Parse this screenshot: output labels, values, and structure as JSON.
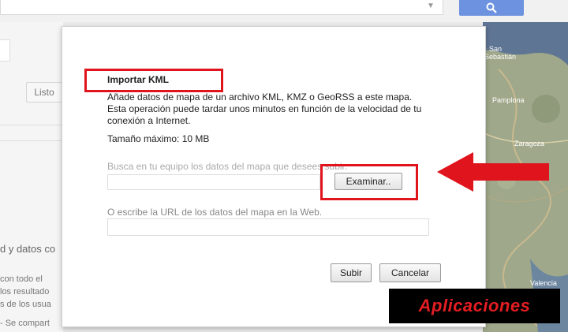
{
  "header": {
    "search_value": "",
    "search_icon": "search-icon"
  },
  "background": {
    "list_button": "Listo",
    "heading": "d y datos co",
    "lines": [
      "con todo el",
      "los resultado",
      "s de los usua",
      "- Se compart"
    ]
  },
  "map": {
    "places": [
      "San",
      "Sebastián",
      "Pamplona",
      "Zaragoza",
      "Valencia"
    ]
  },
  "dialog": {
    "title": "Importar KML",
    "description": "Añade datos de mapa de un archivo KML, KMZ o GeoRSS a este mapa. Esta operación puede tardar unos minutos en función de la velocidad de tu conexión a Internet.",
    "max_size": "Tamaño máximo: 10 MB",
    "browse_label": "Busca en tu equipo los datos del mapa que desees subir.",
    "browse_button": "Examinar..",
    "url_label": "O escribe la URL de los datos del mapa en la Web.",
    "url_value": "",
    "upload_button": "Subir",
    "cancel_button": "Cancelar"
  },
  "watermark": {
    "text": "Aplicaciones"
  },
  "colors": {
    "highlight_red": "#e0141d",
    "search_blue": "#6d92e0"
  }
}
